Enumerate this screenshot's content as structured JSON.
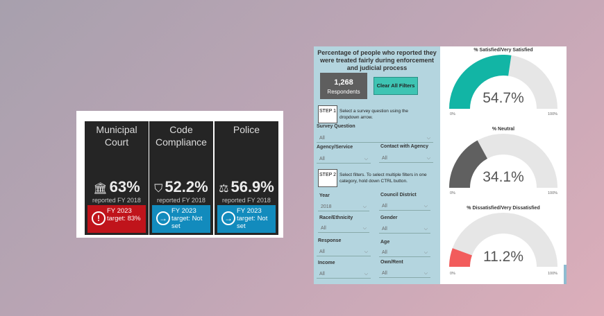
{
  "tiles": [
    {
      "name": "Municipal Court",
      "icon": "🏛",
      "pct": "63%",
      "sub": "reported FY 2018",
      "target": "FY 2023 target: 83%",
      "status": "red"
    },
    {
      "name": "Code Compliance",
      "icon": "⛉",
      "pct": "52.2%",
      "sub": "reported FY 2018",
      "target": "FY 2023 target: Not set",
      "status": "blue"
    },
    {
      "name": "Police",
      "icon": "⚖",
      "pct": "56.9%",
      "sub": "reported FY 2018",
      "target": "FY 2023 target: Not set",
      "status": "blue"
    }
  ],
  "panel": {
    "title": "Percentage of people who reported they were treated fairly during enforcement and judicial process",
    "respondents_count": "1,268",
    "respondents_label": "Respondents",
    "clear_button": "Clear All Filters",
    "step1": "STEP 1",
    "step1_text": "Select a survey question using the dropdown arrow.",
    "survey_question_label": "Survey Question",
    "survey_question_value": "All",
    "agency_label": "Agency/Service",
    "agency_value": "All",
    "contact_label": "Contact with Agency",
    "contact_value": "All",
    "step2": "STEP 2",
    "step2_text": "Select filters.  To select multiple filters in one category, hold down CTRL button.",
    "year_label": "Year",
    "year_value": "2018",
    "district_label": "Council District",
    "district_value": "All",
    "race_label": "Race/Ethnicity",
    "race_value": "All",
    "gender_label": "Gender",
    "gender_value": "All",
    "response_label": "Response",
    "response_value": "All",
    "age_label": "Age",
    "age_value": "All",
    "income_label": "Income",
    "income_value": "All",
    "own_label": "Own/Rent",
    "own_value": "All"
  },
  "gauges": [
    {
      "title": "% Satisfied/Very Satisfied",
      "value": 54.7,
      "label": "54.7%",
      "min": "0%",
      "max": "100%",
      "color": "#12b5a5"
    },
    {
      "title": "% Neutral",
      "value": 34.1,
      "label": "34.1%",
      "min": "0%",
      "max": "100%",
      "color": "#606060"
    },
    {
      "title": "% Dissatisfied/Very Dissatisfied",
      "value": 11.2,
      "label": "11.2%",
      "min": "0%",
      "max": "100%",
      "color": "#f25c5c"
    }
  ]
}
